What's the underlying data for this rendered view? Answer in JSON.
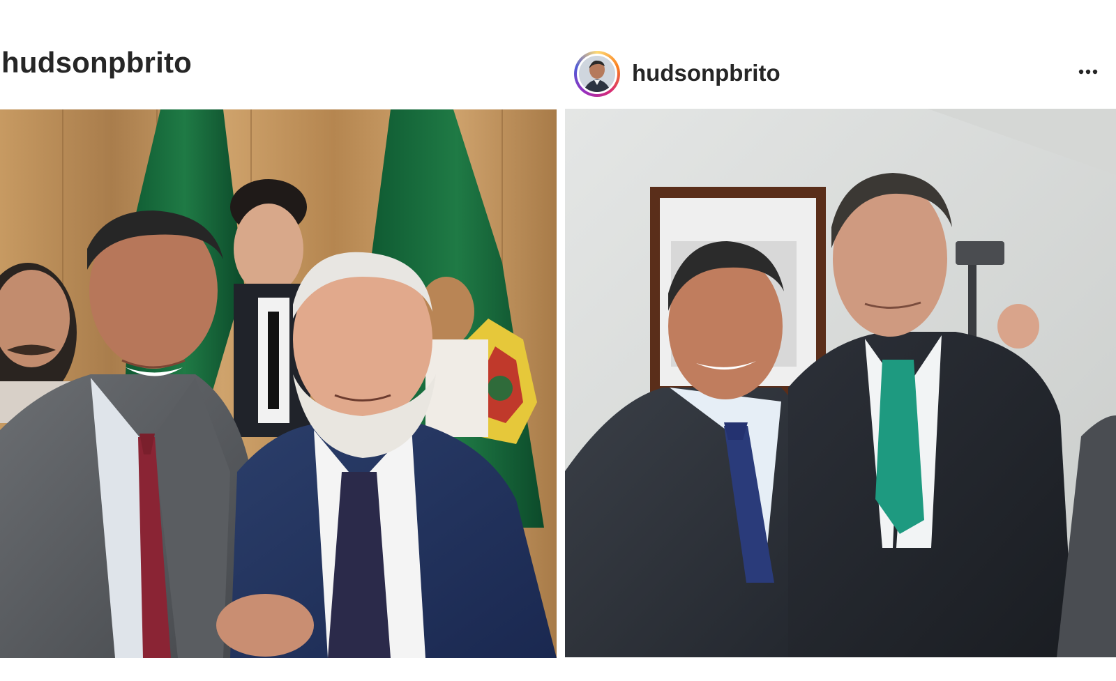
{
  "left_post": {
    "username": "hudsonpbrito",
    "photo_alt": "photo"
  },
  "right_post": {
    "username": "hudsonpbrito",
    "more_label": "...",
    "photo_alt": "photo"
  },
  "icons": {
    "more": "more-options-icon",
    "avatar": "avatar"
  },
  "colors": {
    "text": "#262626",
    "background": "#ffffff",
    "story_ring_start": "#feda75",
    "story_ring_end": "#962fbf"
  }
}
